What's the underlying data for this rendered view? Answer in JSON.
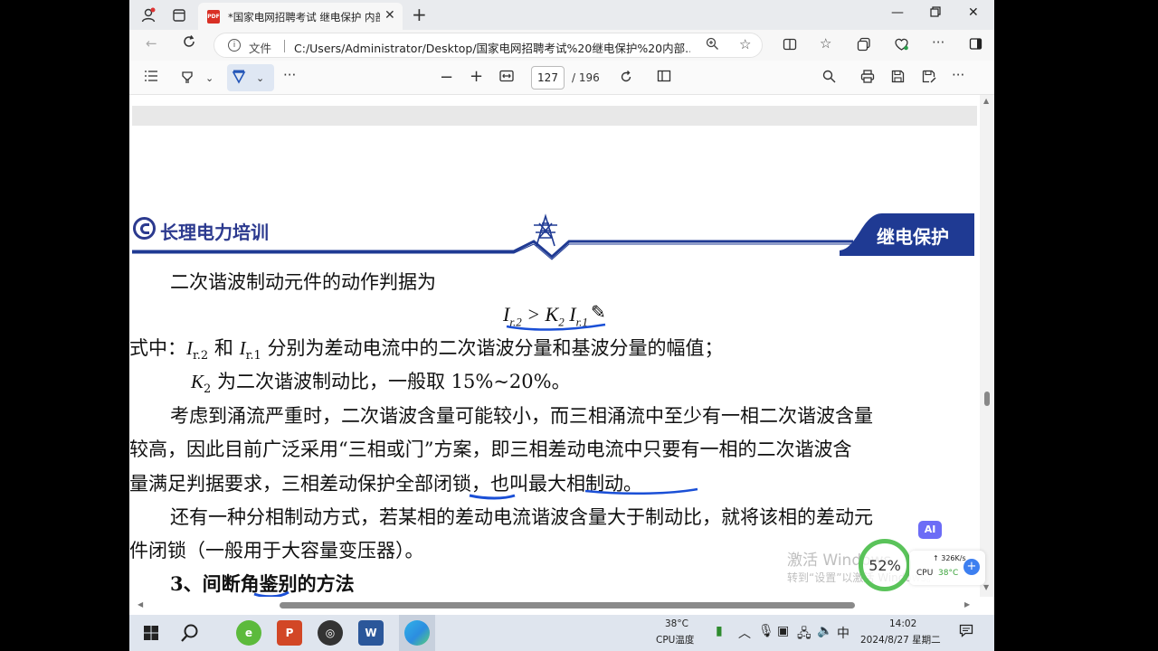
{
  "browser": {
    "tab_title": "*国家电网招聘考试 继电保护 内部",
    "new_tab_symbol": "+",
    "tab_close": "✕",
    "address_label": "文件",
    "url": "C:/Users/Administrator/Desktop/国家电网招聘考试%20继电保护%20内部..."
  },
  "pdf_toolbar": {
    "current_page": "127",
    "total_pages": "/ 196"
  },
  "document": {
    "company": "长理电力培训",
    "section_banner": "继电保护",
    "line1": "二次谐波制动元件的动作判据为",
    "formula": {
      "lhs": "I",
      "lhs_sub": "r.2",
      "op": " > K",
      "k_sub": "2",
      "rhs": " I",
      "rhs_sub": "r.1"
    },
    "line2_prefix": "式中：",
    "line2_i": "I",
    "line2_sub1": "r.2",
    "line2_and": " 和 ",
    "line2_i2": "I",
    "line2_sub2": "r.1",
    "line2_rest": " 分别为差动电流中的二次谐波分量和基波分量的幅值；",
    "line3_k": "K",
    "line3_sub": "2",
    "line3_rest": " 为二次谐波制动比，一般取 15%~20%。",
    "para2_line1": "考虑到涌流严重时，二次谐波含量可能较小，而三相涌流中至少有一相二次谐波含量",
    "para2_line2": "较高，因此目前广泛采用“三相或门”方案，即三相差动电流中只要有一相的二次谐波含",
    "para2_line3": "量满足判据要求，三相差动保护全部闭锁，也叫最大相制动。",
    "para3_line1": "还有一种分相制动方式，若某相的差动电流谐波含量大于制动比，就将该相的差动元",
    "para3_line2": "件闭锁（一般用于大容量变压器）。",
    "heading3": "3、间断角鉴别的方法"
  },
  "overlay": {
    "activate_title": "激活 Windows",
    "activate_sub": "转到“设置”以激活 Windows。",
    "cpu_percent": "52%",
    "net_speed": "↑ 326K/s",
    "net_cpu": "CPU",
    "net_temp": "38°C",
    "ai_badge": "AI",
    "plus": "+"
  },
  "taskbar": {
    "temp_value": "38°C",
    "temp_label": "CPU温度",
    "ime": "中",
    "time": "14:02",
    "date": "2024/8/27 星期二"
  }
}
